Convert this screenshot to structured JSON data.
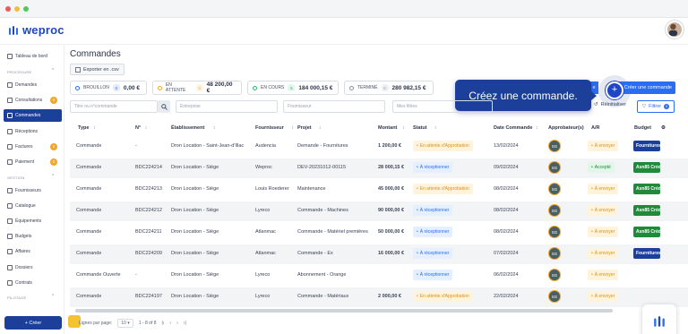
{
  "app": {
    "name": "weproc"
  },
  "sidebar": {
    "items": [
      {
        "label": "Tableau de bord",
        "icon": "grid-icon"
      },
      {
        "section": "PROCÉDURE"
      },
      {
        "label": "Demandes",
        "icon": "hand-icon"
      },
      {
        "label": "Consultations",
        "icon": "document-icon",
        "badge": "0"
      },
      {
        "label": "Commandes",
        "icon": "cart-icon",
        "active": true
      },
      {
        "label": "Réceptions",
        "icon": "inbox-icon"
      },
      {
        "label": "Factures",
        "icon": "invoice-icon",
        "badge": "2"
      },
      {
        "label": "Paiement",
        "icon": "card-icon",
        "badge": "0"
      },
      {
        "section": "GESTION"
      },
      {
        "label": "Fournisseurs",
        "icon": "truck-icon"
      },
      {
        "label": "Catalogue",
        "icon": "basket-icon"
      },
      {
        "label": "Équipements",
        "icon": "wrench-icon"
      },
      {
        "label": "Budgets",
        "icon": "wallet-icon"
      },
      {
        "label": "Affaires",
        "icon": "briefcase-icon"
      },
      {
        "label": "Dossiers",
        "icon": "folder-icon"
      },
      {
        "label": "Contrats",
        "icon": "contract-icon"
      },
      {
        "section": "PILOTAGE"
      }
    ],
    "create_label": "+ Créer"
  },
  "page": {
    "title": "Commandes",
    "export_label": "Exporter en .csv"
  },
  "stats": [
    {
      "label": "BROUILLON",
      "count": "0",
      "amount": "0,00 €",
      "color": "#2a6cf2"
    },
    {
      "label": "EN ATTENTE",
      "count": "3",
      "amount": "48 200,00 €",
      "color": "#f2a62a"
    },
    {
      "label": "EN COURS",
      "count": "5",
      "amount": "184 000,15 €",
      "color": "#2bb673"
    },
    {
      "label": "TERMINÉ",
      "count": "0",
      "amount": "280 982,15 €",
      "color": "#8a91a0"
    }
  ],
  "tooltip": {
    "text": "Créez une commande."
  },
  "create_command": {
    "label": "Créer une commande",
    "partial": "e"
  },
  "filters": {
    "search_placeholder": "Titre ou n°commande",
    "entreprise": "Entreprise",
    "fournisseur": "Fournisseur",
    "mes_filtres": "Mes filtres",
    "reset_label": "Réinitialiser",
    "filter_label": "Filtrer",
    "filter_count": "0"
  },
  "table": {
    "headers": [
      "Type",
      "N°",
      "Établissement",
      "Fournisseur",
      "Projet",
      "Montant",
      "Statut",
      "Date Commande",
      "Approbateur(s)",
      "A/R",
      "Budget"
    ],
    "rows": [
      {
        "type": "Commande",
        "num": "-",
        "etab": "Dron Location - Saint-Jean-d'Illac",
        "fournisseur": "Audencia",
        "projet": "Demande - Fournitures",
        "montant": "1 200,00 €",
        "statut": "En attente d'Approbation",
        "statut_kind": "wait",
        "date": "13/02/2024",
        "appr": "SG",
        "ar": "À envoyer",
        "ar_kind": "send",
        "budget": "Fournitures",
        "budget_color": "#1c3f99"
      },
      {
        "type": "Commande",
        "num": "BDC224214",
        "etab": "Dron Location - Siège",
        "fournisseur": "Weproc",
        "projet": "DEV-20231012-00115",
        "montant": "28 000,15 €",
        "statut": "À réceptionner",
        "statut_kind": "recv",
        "date": "09/02/2024",
        "appr": "SG",
        "ar": "Accepté",
        "ar_kind": "ok",
        "budget": "Asn85 Crédit",
        "budget_color": "#1f8a3a"
      },
      {
        "type": "Commande",
        "num": "BDC224213",
        "etab": "Dron Location - Siège",
        "fournisseur": "Louis Roederer",
        "projet": "Maintenance",
        "montant": "45 000,00 €",
        "statut": "En attente d'Approbation",
        "statut_kind": "wait",
        "date": "08/02/2024",
        "appr": "SG",
        "ar": "À envoyer",
        "ar_kind": "send",
        "budget": "Asn85 Crédit",
        "budget_color": "#1f8a3a"
      },
      {
        "type": "Commande",
        "num": "BDC224212",
        "etab": "Dron Location - Siège",
        "fournisseur": "Lyreco",
        "projet": "Commande - Machines",
        "montant": "90 000,00 €",
        "statut": "À réceptionner",
        "statut_kind": "recv",
        "date": "08/02/2024",
        "appr": "SG",
        "ar": "À envoyer",
        "ar_kind": "send",
        "budget": "Asn85 Crédit",
        "budget_color": "#1f8a3a"
      },
      {
        "type": "Commande",
        "num": "BDC224211",
        "etab": "Dron Location - Siège",
        "fournisseur": "Atlanmac",
        "projet": "Commande - Matériel premières",
        "montant": "50 000,00 €",
        "statut": "À réceptionner",
        "statut_kind": "recv",
        "date": "08/02/2024",
        "appr": "SG",
        "ar": "À envoyer",
        "ar_kind": "send",
        "budget": "Asn85 Crédit",
        "budget_color": "#1f8a3a"
      },
      {
        "type": "Commande",
        "num": "BDC224209",
        "etab": "Dron Location - Siège",
        "fournisseur": "Atlanmac",
        "projet": "Commande - Ex",
        "montant": "16 000,00 €",
        "statut": "À réceptionner",
        "statut_kind": "recv",
        "date": "07/02/2024",
        "appr": "SG",
        "ar": "À envoyer",
        "ar_kind": "send",
        "budget": "Fournitures",
        "budget_color": "#1c3f99"
      },
      {
        "type": "Commande Ouverte",
        "num": "-",
        "etab": "Dron Location - Siège",
        "fournisseur": "Lyreco",
        "projet": "Abonnement - Orange",
        "montant": "",
        "statut": "À réceptionner",
        "statut_kind": "recv",
        "date": "06/02/2024",
        "appr": "SG",
        "ar": "À envoyer",
        "ar_kind": "send",
        "budget": "",
        "budget_color": ""
      },
      {
        "type": "Commande",
        "num": "BDC224197",
        "etab": "Dron Location - Siège",
        "fournisseur": "Lyreco",
        "projet": "Commande - Matériaux",
        "montant": "2 000,00 €",
        "statut": "En attente d'Approbation",
        "statut_kind": "wait",
        "date": "22/02/2024",
        "appr": "SG",
        "ar": "À envoyer",
        "ar_kind": "send",
        "budget": "",
        "budget_color": ""
      }
    ]
  },
  "footer": {
    "per_page_label": "Lignes par page:",
    "per_page_value": "10",
    "range": "1 - 8 of 8"
  },
  "colors": {
    "brand": "#1c3f99",
    "accent": "#2a6cf2",
    "wait_bg": "#fff3dc",
    "wait_fg": "#d9901a",
    "recv_bg": "#e4efff",
    "recv_fg": "#2a6cf2"
  }
}
